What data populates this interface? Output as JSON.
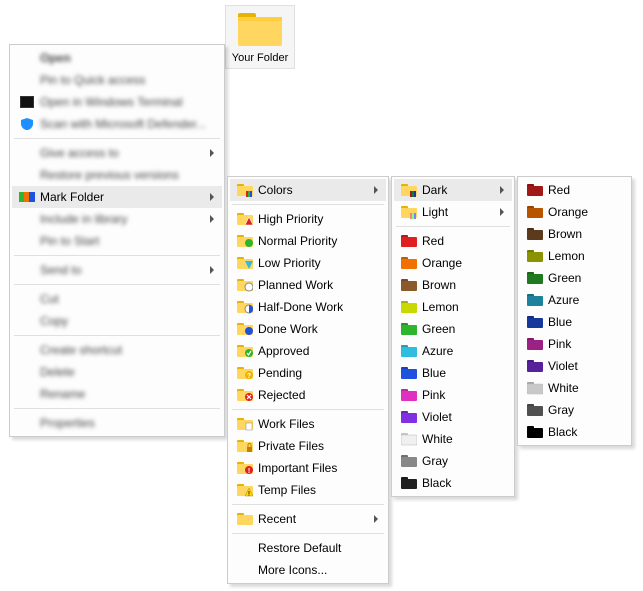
{
  "desktop": {
    "folder_label": "Your Folder"
  },
  "main_menu": {
    "open": "Open",
    "pin_quick": "Pin to Quick access",
    "open_terminal": "Open in Windows Terminal",
    "scan_defender": "Scan with Microsoft Defender...",
    "give_access": "Give access to",
    "restore_versions": "Restore previous versions",
    "mark_folder": "Mark Folder",
    "include_library": "Include in library",
    "pin_start": "Pin to Start",
    "send_to": "Send to",
    "cut": "Cut",
    "copy": "Copy",
    "create_shortcut": "Create shortcut",
    "delete": "Delete",
    "rename": "Rename",
    "properties": "Properties"
  },
  "sub1": {
    "colors": "Colors",
    "high_priority": "High Priority",
    "normal_priority": "Normal Priority",
    "low_priority": "Low Priority",
    "planned_work": "Planned Work",
    "half_done": "Half-Done Work",
    "done_work": "Done Work",
    "approved": "Approved",
    "pending": "Pending",
    "rejected": "Rejected",
    "work_files": "Work Files",
    "private_files": "Private Files",
    "important_files": "Important Files",
    "temp_files": "Temp Files",
    "recent": "Recent",
    "restore_default": "Restore Default",
    "more_icons": "More Icons..."
  },
  "sub2": {
    "dark": "Dark",
    "light": "Light",
    "red": "Red",
    "orange": "Orange",
    "brown": "Brown",
    "lemon": "Lemon",
    "green": "Green",
    "azure": "Azure",
    "blue": "Blue",
    "pink": "Pink",
    "violet": "Violet",
    "white": "White",
    "gray": "Gray",
    "black": "Black"
  },
  "sub3": {
    "red": "Red",
    "orange": "Orange",
    "brown": "Brown",
    "lemon": "Lemon",
    "green": "Green",
    "azure": "Azure",
    "blue": "Blue",
    "pink": "Pink",
    "violet": "Violet",
    "white": "White",
    "gray": "Gray",
    "black": "Black"
  },
  "colors": {
    "red": "#e02020",
    "orange": "#f07000",
    "brown": "#8b5a2b",
    "lemon": "#c8d800",
    "green": "#2eb52e",
    "azure": "#2ebce0",
    "blue": "#2050e0",
    "pink": "#e030c0",
    "violet": "#8030e0",
    "white": "#f0f0f0",
    "gray": "#888888",
    "black": "#202020",
    "dark_red": "#a01818",
    "dark_orange": "#b85400",
    "dark_brown": "#5c3a1c",
    "dark_lemon": "#8a9400",
    "dark_green": "#1f7a1f",
    "dark_azure": "#1f829c",
    "dark_blue": "#16389c",
    "dark_pink": "#9c2184",
    "dark_violet": "#58219c",
    "dark_white": "#c8c8c8",
    "dark_gray": "#505050",
    "dark_black": "#000000"
  }
}
